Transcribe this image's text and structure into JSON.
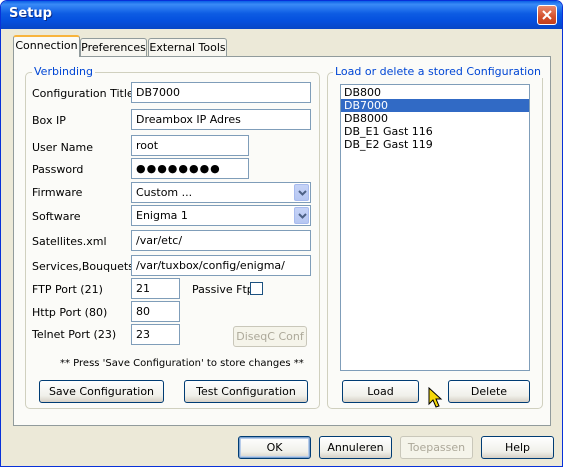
{
  "window": {
    "title": "Setup"
  },
  "tabs": [
    "Connection",
    "Preferences",
    "External Tools"
  ],
  "verbinding": {
    "legend": "Verbinding",
    "fields": {
      "config_title": {
        "label": "Configuration Title",
        "value": "DB7000"
      },
      "box_ip": {
        "label": "Box IP",
        "value": "Dreambox IP Adres"
      },
      "user_name": {
        "label": "User Name",
        "value": "root"
      },
      "password": {
        "label": "Password",
        "value": "●●●●●●●●"
      },
      "firmware": {
        "label": "Firmware",
        "value": "Custom ..."
      },
      "software": {
        "label": "Software",
        "value": "Enigma 1"
      },
      "satellites": {
        "label": "Satellites.xml",
        "value": "/var/etc/"
      },
      "services": {
        "label": "Services,Bouquets",
        "value": "/var/tuxbox/config/enigma/"
      },
      "ftp_port": {
        "label": "FTP Port (21)",
        "value": "21"
      },
      "http_port": {
        "label": "Http Port (80)",
        "value": "80"
      },
      "telnet_port": {
        "label": "Telnet Port (23)",
        "value": "23"
      }
    },
    "passive_ftp": {
      "label": "Passive Ftp",
      "checked": false
    },
    "diseqc_button": "DiseqC Conf",
    "hint": "** Press 'Save Configuration' to store changes **",
    "save_button": "Save Configuration",
    "test_button": "Test Configuration"
  },
  "stored": {
    "legend": "Load or delete a stored Configuration",
    "items": [
      "DB800",
      "DB7000",
      "DB8000",
      "DB_E1 Gast 116",
      "DB_E2 Gast 119"
    ],
    "selected": "DB7000",
    "load_button": "Load",
    "delete_button": "Delete"
  },
  "footer": {
    "ok": "OK",
    "cancel": "Annuleren",
    "apply": "Toepassen",
    "help": "Help"
  },
  "colors": {
    "titlebar": "#0550de",
    "accent_legend": "#0046d5",
    "selection": "#316ac5",
    "close": "#d4502c"
  },
  "icons": {
    "close": "close-icon",
    "dropdown": "chevron-down-icon",
    "cursor": "mouse-pointer-icon"
  }
}
